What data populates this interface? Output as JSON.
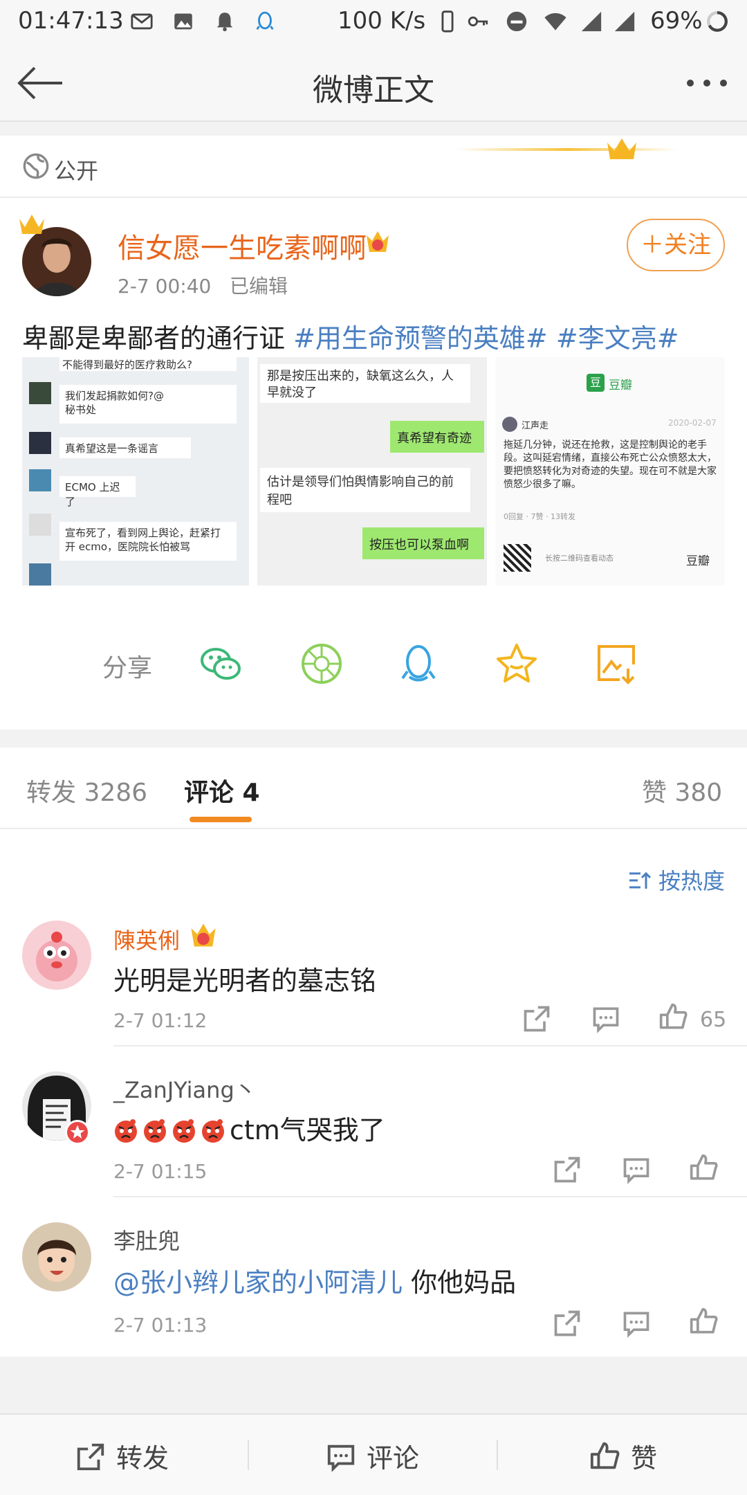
{
  "status_bar": {
    "time": "01:47:13",
    "net_speed": "100 K/s",
    "battery": "69%"
  },
  "header": {
    "title": "微博正文"
  },
  "post": {
    "visibility": "公开",
    "author": "信女愿一生吃素啊啊",
    "time": "2-7 00:40",
    "edited": "已编辑",
    "follow_label": "＋关注",
    "text": "卑鄙是卑鄙者的通行证 ",
    "hashtags": [
      "#用生命预警的英雄#",
      "#李文亮#"
    ],
    "images": {
      "img1": {
        "lines": [
          "不能得到最好的医疗救助么?",
          "我们发起捐款如何?@",
          "秘书处",
          "真希望这是一条谣言",
          "ECMO 上迟了",
          "宣布死了，看到网上舆论，赶紧打",
          "开 ecmo，医院院长怕被骂"
        ]
      },
      "img2": {
        "lines": [
          "那是按压出来的，缺氧这么久，人",
          "早就没了",
          "真希望有奇迹",
          "估计是领导们怕舆情影响自己的前",
          "程吧",
          "按压也可以泵血啊"
        ]
      },
      "img3": {
        "brand": "豆瓣",
        "user": "江声走",
        "date": "2020-02-07",
        "body": [
          "拖延几分钟，说还在抢救，这是控制舆论的老手",
          "段。这叫延宕情绪，直接公布死亡公众愤怒太大，",
          "要把愤怒转化为对奇迹的失望。现在可不就是大家",
          "愤怒少很多了嘛。"
        ],
        "stats": "0回复 · 7赞 · 13转发",
        "qr_hint": "长按二维码查看动态"
      }
    },
    "share_label": "分享"
  },
  "tabs": {
    "reposts": "转发 3286",
    "comments": "评论 4",
    "likes": "赞 380"
  },
  "comments": {
    "sort_label": "按热度",
    "items": [
      {
        "name": "陳英俐",
        "text": "光明是光明者的墓志铭",
        "time": "2-7 01:12",
        "likes": "65"
      },
      {
        "name": "_ZanJYiang丶",
        "text": "ctm气哭我了",
        "time": "2-7 01:15"
      },
      {
        "name": "李肚兜",
        "mention": "@张小辫儿家的小阿清儿",
        "text": " 你他妈品",
        "time": "2-7 01:13"
      }
    ]
  },
  "bottom_bar": {
    "repost": "转发",
    "comment": "评论",
    "like": "赞"
  }
}
